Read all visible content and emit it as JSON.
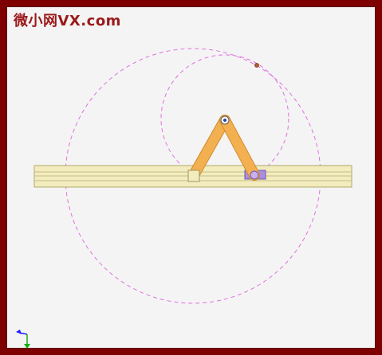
{
  "watermark": {
    "text": "微小网VX.com"
  },
  "colors": {
    "frame": "#7e0000",
    "canvas": "#f4f4f4",
    "watermark": "#9b1a1a",
    "rail_fill": "#f2ecbe",
    "rail_stroke": "#b3a86a",
    "link": "#f2b050",
    "link_stroke": "#d38a2a",
    "slider_left": "#f2ecbe",
    "slider_right": "#a98ee0",
    "trace_circle": "#e070e0",
    "tracer_point": "#b06030",
    "axis_x": "#2020ff",
    "axis_y": "#10b010"
  },
  "mechanism": {
    "type": "two-slider linkage on horizontal guide",
    "links": [
      "left-link",
      "right-link"
    ],
    "sliders": [
      "left-slider",
      "right-slider"
    ],
    "trace_paths": [
      "large-dashed-circle",
      "small-dashed-circle"
    ]
  }
}
